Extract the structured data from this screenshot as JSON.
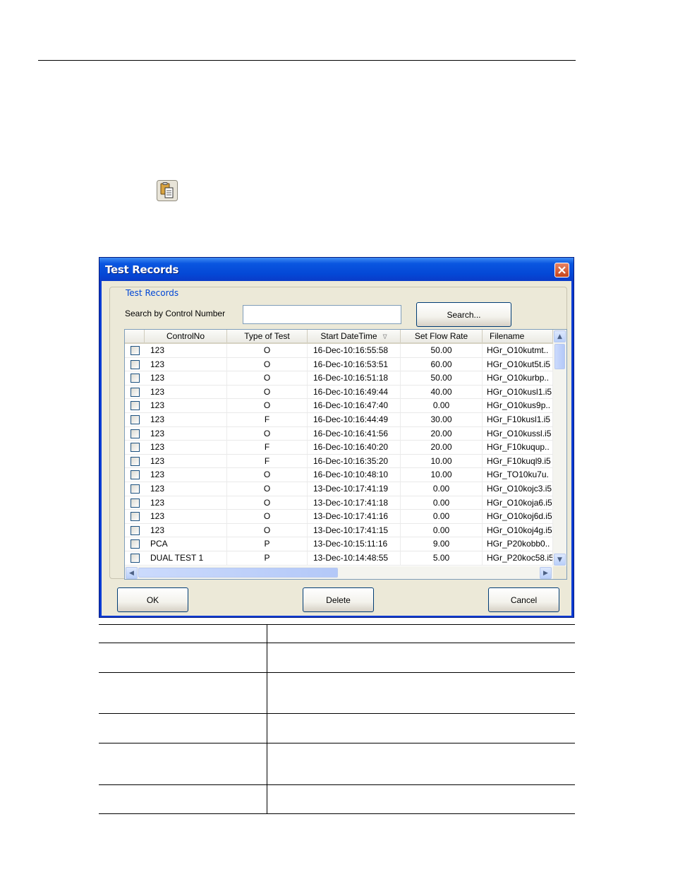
{
  "dialog": {
    "title": "Test Records",
    "group_label": "Test Records",
    "search_label": "Search by Control Number",
    "search_value": "",
    "search_button": "Search...",
    "columns": [
      "",
      "ControlNo",
      "Type of Test",
      "Start DateTime",
      "Set Flow Rate",
      "Filename"
    ],
    "sort_indicator": "∇",
    "rows": [
      {
        "control": "123",
        "type": "O",
        "datetime": "16-Dec-10:16:55:58",
        "flow": "50.00",
        "file": "HGr_O10kutmt.."
      },
      {
        "control": "123",
        "type": "O",
        "datetime": "16-Dec-10:16:53:51",
        "flow": "60.00",
        "file": "HGr_O10kut5t.i5"
      },
      {
        "control": "123",
        "type": "O",
        "datetime": "16-Dec-10:16:51:18",
        "flow": "50.00",
        "file": "HGr_O10kurbp.."
      },
      {
        "control": "123",
        "type": "O",
        "datetime": "16-Dec-10:16:49:44",
        "flow": "40.00",
        "file": "HGr_O10kusl1.i5"
      },
      {
        "control": "123",
        "type": "O",
        "datetime": "16-Dec-10:16:47:40",
        "flow": "0.00",
        "file": "HGr_O10kus9p.."
      },
      {
        "control": "123",
        "type": "F",
        "datetime": "16-Dec-10:16:44:49",
        "flow": "30.00",
        "file": "HGr_F10kusl1.i5"
      },
      {
        "control": "123",
        "type": "O",
        "datetime": "16-Dec-10:16:41:56",
        "flow": "20.00",
        "file": "HGr_O10kussl.i5"
      },
      {
        "control": "123",
        "type": "F",
        "datetime": "16-Dec-10:16:40:20",
        "flow": "20.00",
        "file": "HGr_F10kuqup.."
      },
      {
        "control": "123",
        "type": "F",
        "datetime": "16-Dec-10:16:35:20",
        "flow": "10.00",
        "file": "HGr_F10kuql9.i5"
      },
      {
        "control": "123",
        "type": "O",
        "datetime": "16-Dec-10:10:48:10",
        "flow": "10.00",
        "file": "HGr_TO10ku7u."
      },
      {
        "control": "123",
        "type": "O",
        "datetime": "13-Dec-10:17:41:19",
        "flow": "0.00",
        "file": "HGr_O10kojc3.i5"
      },
      {
        "control": "123",
        "type": "O",
        "datetime": "13-Dec-10:17:41:18",
        "flow": "0.00",
        "file": "HGr_O10koja6.i5"
      },
      {
        "control": "123",
        "type": "O",
        "datetime": "13-Dec-10:17:41:16",
        "flow": "0.00",
        "file": "HGr_O10koj6d.i5"
      },
      {
        "control": "123",
        "type": "O",
        "datetime": "13-Dec-10:17:41:15",
        "flow": "0.00",
        "file": "HGr_O10koj4g.i5"
      },
      {
        "control": "PCA",
        "type": "P",
        "datetime": "13-Dec-10:15:11:16",
        "flow": "9.00",
        "file": "HGr_P20kobb0.."
      },
      {
        "control": "DUAL TEST 1",
        "type": "P",
        "datetime": "13-Dec-10:14:48:55",
        "flow": "5.00",
        "file": "HGr_P20koc58.i5"
      }
    ],
    "ok_button": "OK",
    "delete_button": "Delete",
    "cancel_button": "Cancel"
  },
  "icons": {
    "records": "records-icon",
    "close": "close-icon",
    "scroll_up": "scroll-up-arrow-icon",
    "scroll_down": "scroll-down-arrow-icon",
    "scroll_left": "scroll-left-arrow-icon",
    "scroll_right": "scroll-right-arrow-icon"
  },
  "colors": {
    "titlebar": "#0448d6",
    "dialog_face": "#ece9d8",
    "group_label": "#0046d5",
    "close_button": "#c4441a"
  }
}
